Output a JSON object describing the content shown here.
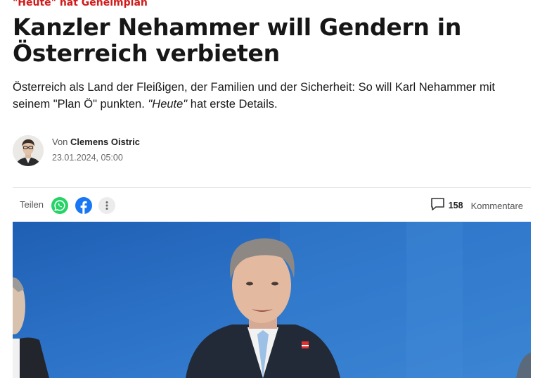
{
  "article": {
    "kicker": "\"Heute\" hat Geheimplan",
    "headline": "Kanzler Nehammer will Gendern in Österreich verbieten",
    "lead_text": "Österreich als Land der Fleißigen, der Familien und der Sicherheit: So will Karl Nehammer mit seinem \"Plan Ö\" punkten.",
    "lead_source": "\"Heute\"",
    "lead_tail": "hat erste Details."
  },
  "author": {
    "prefix": "Von",
    "name": "Clemens Oistric",
    "date": "23.01.2024, 05:00"
  },
  "share": {
    "label": "Teilen",
    "icons": [
      "whatsapp-icon",
      "facebook-icon",
      "more-icon"
    ]
  },
  "comments": {
    "count": "158",
    "label": "Kommentare"
  },
  "colors": {
    "kicker": "#d21a1a",
    "whatsapp": "#25d366",
    "facebook": "#1877f2",
    "hero_background": "#2a6fc1"
  }
}
